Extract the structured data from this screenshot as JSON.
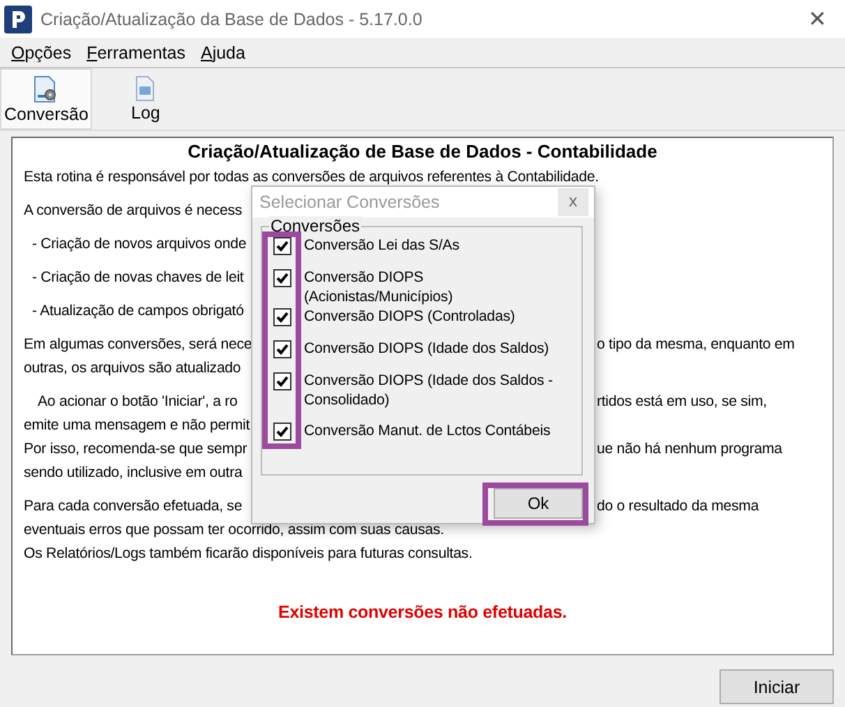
{
  "window": {
    "title": "Criação/Atualização da Base de Dados - 5.17.0.0",
    "close": "✕"
  },
  "menu": [
    {
      "label": "Opções"
    },
    {
      "label": "Ferramentas"
    },
    {
      "label": "Ajuda"
    }
  ],
  "toolbar": [
    {
      "label": "Conversão",
      "kind": "convert",
      "selected": true
    },
    {
      "label": "Log",
      "kind": "log",
      "selected": false
    }
  ],
  "panel": {
    "heading": "Criação/Atualização de Base de Dados - Contabilidade",
    "paragraphs": [
      {
        "kind": "plain",
        "lines": [
          {
            "text": "Esta rotina é responsável por todas as conversões de arquivos referentes à Contabilidade."
          }
        ]
      },
      {
        "kind": "plain",
        "lines": [
          {
            "text": "A conversão de arquivos é necess"
          }
        ]
      },
      {
        "kind": "bullet",
        "lines": [
          {
            "text": "- Criação de novos arquivos onde"
          }
        ]
      },
      {
        "kind": "bullet",
        "lines": [
          {
            "text": "- Criação de novas chaves de leit"
          }
        ]
      },
      {
        "kind": "bullet",
        "lines": [
          {
            "text": "- Atualização de campos obrigató"
          }
        ]
      },
      {
        "kind": "plain",
        "lines": [
          {
            "text": "Em algumas conversões, será nece",
            "right": "o tipo da mesma, enquanto em"
          },
          {
            "text": "outras, os arquivos são atualizado"
          }
        ]
      },
      {
        "kind": "indented",
        "lines": [
          {
            "text": "Ao acionar o botão 'Iniciar', a ro",
            "right": "rtidos está em uso, se sim,"
          },
          {
            "text": "emite uma mensagem e não permit"
          },
          {
            "text": "Por isso, recomenda-se que sempr",
            "right": "ue não há nenhum programa"
          },
          {
            "text": "sendo utilizado, inclusive em outra"
          }
        ]
      },
      {
        "kind": "plain",
        "lines": [
          {
            "text": "Para cada conversão efetuada, se",
            "right": "do o resultado da mesma"
          },
          {
            "text": "eventuais erros que possam ter ocorrido, assim com suas causas."
          },
          {
            "text": "Os Relatórios/Logs também ficarão disponíveis para futuras consultas."
          }
        ]
      }
    ],
    "warning": "Existem conversões não efetuadas."
  },
  "start_button": "Iniciar",
  "dialog": {
    "title": "Selecionar Conversões",
    "active": false,
    "close": "x",
    "group": "Conversões",
    "checkboxes_highlighted": true,
    "options": [
      {
        "label": "Conversão Lei das S/As",
        "checked": true
      },
      {
        "label": "Conversão DIOPS (Acionistas/Municípios)",
        "checked": true
      },
      {
        "label": "Conversão DIOPS (Controladas)",
        "checked": true
      },
      {
        "label": "Conversão DIOPS (Idade dos Saldos)",
        "checked": true
      },
      {
        "label": "Conversão DIOPS (Idade dos Saldos - Consolidado)",
        "checked": true
      },
      {
        "label": "Conversão Manut. de Lctos Contábeis",
        "checked": true
      }
    ],
    "ok": "Ok",
    "ok_highlighted": true
  }
}
